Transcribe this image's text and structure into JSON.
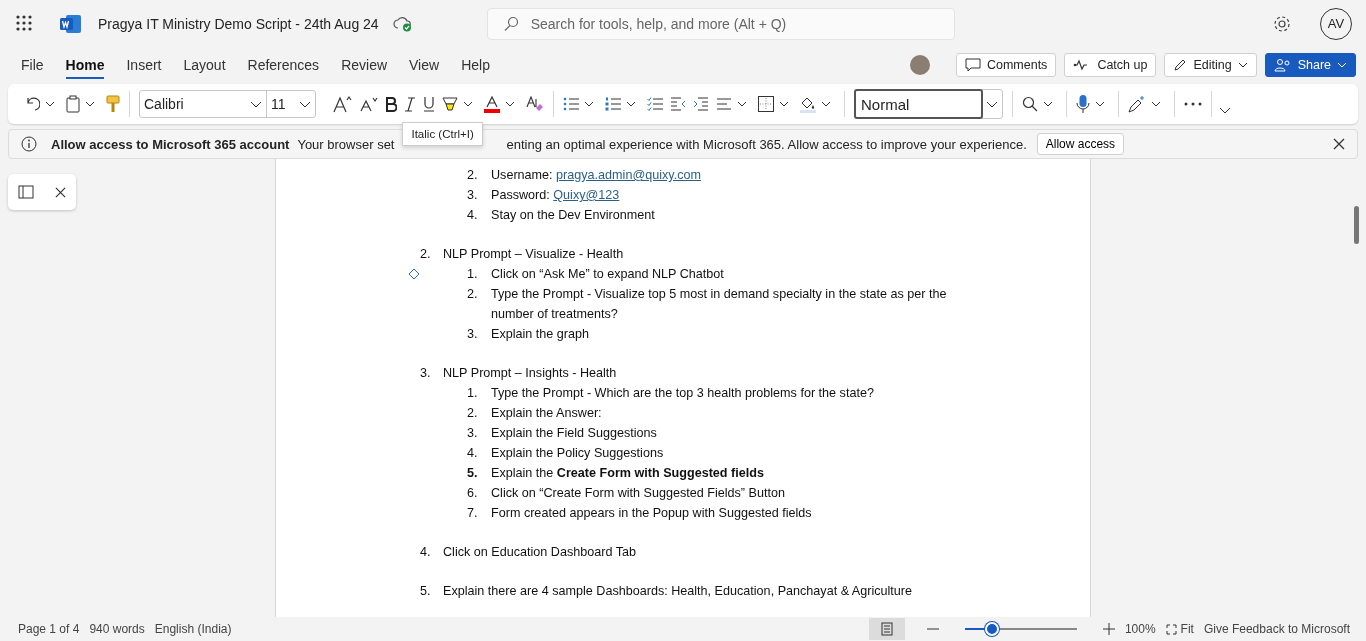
{
  "title_bar": {
    "document_title": "Pragya IT Ministry Demo Script - 24th Aug 24",
    "search": {
      "placeholder": "Search for tools, help, and more (Alt + Q)"
    },
    "avatar": "AV"
  },
  "menu_tabs": [
    {
      "label": "File",
      "selected": false
    },
    {
      "label": "Home",
      "selected": true
    },
    {
      "label": "Insert",
      "selected": false
    },
    {
      "label": "Layout",
      "selected": false
    },
    {
      "label": "References",
      "selected": false
    },
    {
      "label": "Review",
      "selected": false
    },
    {
      "label": "View",
      "selected": false
    },
    {
      "label": "Help",
      "selected": false
    }
  ],
  "header_buttons": [
    {
      "kind": "comments",
      "label": "Comments"
    },
    {
      "kind": "catchup",
      "label": "Catch up"
    },
    {
      "kind": "editing",
      "label": "Editing"
    },
    {
      "kind": "share",
      "label": "Share"
    }
  ],
  "ribbon": {
    "font": "Calibri",
    "size": "11",
    "style": "Normal"
  },
  "tooltip": "Italic (Ctrl+I)",
  "banner": {
    "title": "Allow access to Microsoft 365 account",
    "text_before": "Your browser set",
    "text_after": "enting an optimal experience with Microsoft 365. Allow access to improve your experience.",
    "button": "Allow access"
  },
  "document": {
    "continued_list": [
      {
        "number": "2.",
        "text": "Username: ",
        "link": "pragya.admin@quixy.com"
      },
      {
        "number": "3.",
        "text": "Password: ",
        "link": "Quixy@123"
      },
      {
        "number": "4.",
        "text": "Stay on the Dev Environment"
      }
    ],
    "sections": [
      {
        "number": "2.",
        "text": "NLP Prompt – Visualize - Health",
        "children": [
          {
            "number": "1.",
            "text": "Click on “Ask Me” to expand NLP Chatbot"
          },
          {
            "number": "2.",
            "text": "Type the Prompt - Visualize top 5 most in demand specialty in the state as per the number of treatments?"
          },
          {
            "number": "3.",
            "text": "Explain the graph"
          }
        ]
      },
      {
        "number": "3.",
        "text": "NLP Prompt – Insights - Health",
        "children": [
          {
            "number": "1.",
            "text": "Type the Prompt - Which are the top 3 health problems for the state?"
          },
          {
            "number": "2.",
            "text": "Explain the Answer:"
          },
          {
            "number": "3.",
            "text": "Explain the Field Suggestions"
          },
          {
            "number": "4.",
            "text": "Explain the Policy Suggestions"
          },
          {
            "number": "**5.**",
            "text": "Explain the **Create Form with Suggested fields**"
          },
          {
            "number": "6.",
            "text": "Click on “Create Form with Suggested Fields” Button"
          },
          {
            "number": "7.",
            "text": "Form created appears in the Popup with Suggested fields"
          }
        ]
      },
      {
        "number": "4.",
        "text": "Click on Education Dashboard Tab"
      },
      {
        "number": "5.",
        "text": "Explain there are 4 sample Dashboards: Health, Education, Panchayat & Agriculture"
      }
    ]
  },
  "status_bar": {
    "page": "Page 1 of 4",
    "words": "940 words",
    "language": "English (India)",
    "zoom": {
      "level": 0.23
    },
    "zoom_text": "100%",
    "fit": "Fit",
    "feedback": "Give Feedback to Microsoft"
  }
}
